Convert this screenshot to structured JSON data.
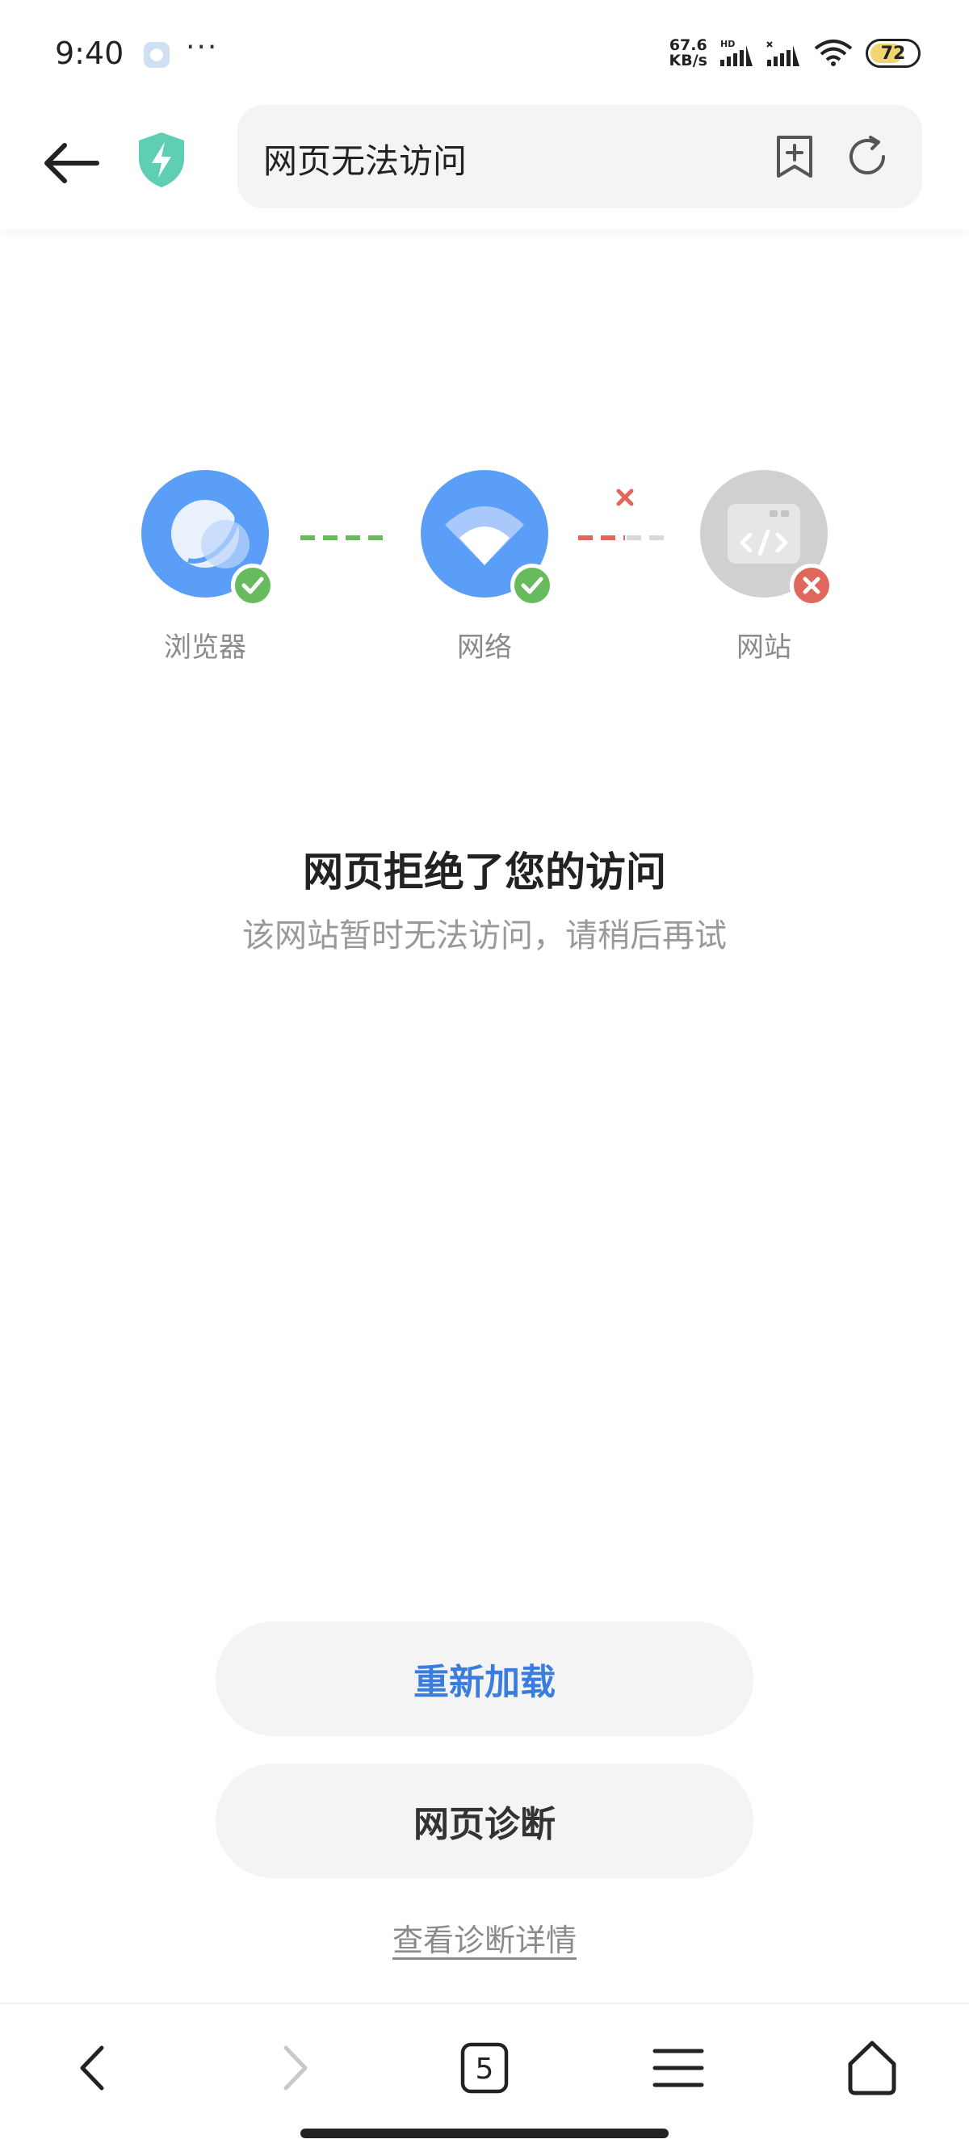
{
  "status_bar": {
    "time": "9:40",
    "dots": "···",
    "net_speed_value": "67.6",
    "net_speed_unit": "KB/s",
    "sim1_label": "HD",
    "battery_level": "72",
    "battery_color": "#f1d571"
  },
  "header": {
    "url_text": "网页无法访问",
    "shield_color": "#5fcfb3"
  },
  "diagram": {
    "nodes": [
      {
        "label": "浏览器",
        "status": "ok",
        "color": "#5b9ef7"
      },
      {
        "label": "网络",
        "status": "ok",
        "color": "#5b9ef7"
      },
      {
        "label": "网站",
        "status": "error",
        "color": "#d0d0d0"
      }
    ],
    "ok_color": "#67bb5c",
    "error_color": "#e0675c"
  },
  "message": {
    "title": "网页拒绝了您的访问",
    "subtitle": "该网站暂时无法访问，请稍后再试"
  },
  "actions": {
    "reload_label": "重新加载",
    "diagnose_label": "网页诊断",
    "details_link": "查看诊断详情",
    "accent_color": "#3b7ddd"
  },
  "bottom_nav": {
    "tab_count": "5",
    "items": [
      "back-icon",
      "forward-icon",
      "tabs-icon",
      "menu-icon",
      "home-icon"
    ]
  }
}
